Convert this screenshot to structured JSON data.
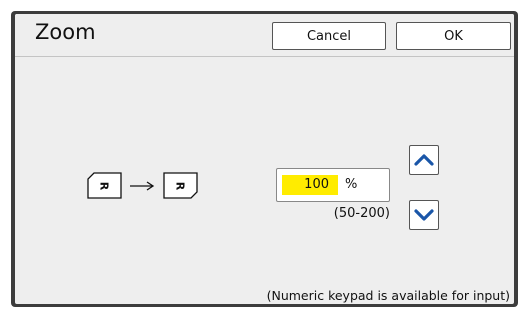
{
  "dialog": {
    "title": "Zoom",
    "cancel_label": "Cancel",
    "ok_label": "OK"
  },
  "zoom": {
    "value": "100",
    "unit": "%",
    "range": "(50-200)",
    "diagram_letter": "R"
  },
  "icons": {
    "increase": "chevron-up-icon",
    "decrease": "chevron-down-icon",
    "arrow": "right-arrow-icon"
  },
  "colors": {
    "accent": "#1a56a8",
    "highlight": "#ffec00"
  },
  "footer": {
    "note": "(Numeric keypad is available for input)"
  }
}
